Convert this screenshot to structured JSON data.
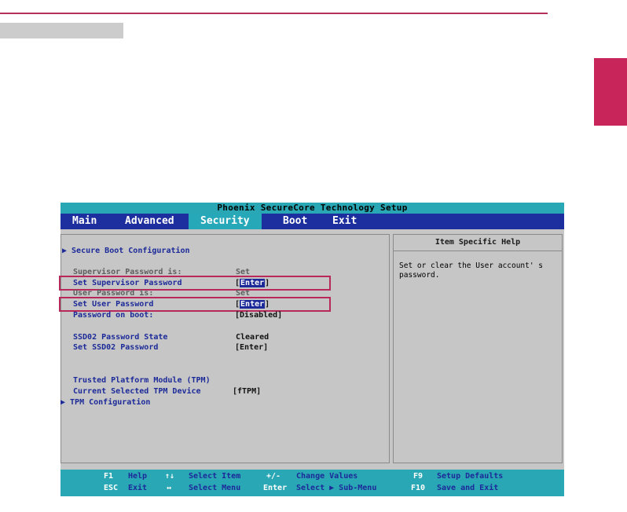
{
  "bios": {
    "title": "Phoenix SecureCore Technology Setup",
    "menu": [
      "Main",
      "Advanced",
      "Security",
      "Boot",
      "Exit"
    ],
    "active_menu": "Security",
    "items": {
      "secure_boot": "▶ Secure Boot Configuration",
      "supervisor_pw_is": "Supervisor Password is:",
      "supervisor_pw_is_value": "Set",
      "set_supervisor_pw": "Set Supervisor Password",
      "set_supervisor_pw_value": "Enter",
      "user_pw_is": "User Password is:",
      "user_pw_is_value": "Set",
      "set_user_pw": "Set User Password",
      "set_user_pw_value": "Enter",
      "pw_on_boot": "Password on boot:",
      "pw_on_boot_value": "[Disabled]",
      "ssd_state": "SSD02 Password State",
      "ssd_state_value": "Cleared",
      "ssd_set": "Set SSD02 Password",
      "ssd_set_value": "[Enter]",
      "tpm_title": "Trusted Platform Module (TPM)",
      "tpm_device": "Current Selected TPM Device",
      "tpm_device_value": "[fTPM]",
      "tpm_config": "▶ TPM Configuration"
    },
    "help": {
      "heading": "Item Specific Help",
      "text": "Set or clear the User account' s password."
    },
    "footer": {
      "f1_key": "F1",
      "f1_label": "Help",
      "esc_key": "ESC",
      "esc_label": "Exit",
      "arrows_ud_key": "↑↓",
      "arrows_ud_label": "Select Item",
      "arrows_lr_key": "↔",
      "arrows_lr_label": "Select Menu",
      "pm_key": "+/-",
      "pm_label": "Change Values",
      "enter_key": "Enter",
      "enter_label": "Select ▶ Sub-Menu",
      "f9_key": "F9",
      "f9_label": "Setup Defaults",
      "f10_key": "F10",
      "f10_label": "Save and Exit"
    }
  }
}
